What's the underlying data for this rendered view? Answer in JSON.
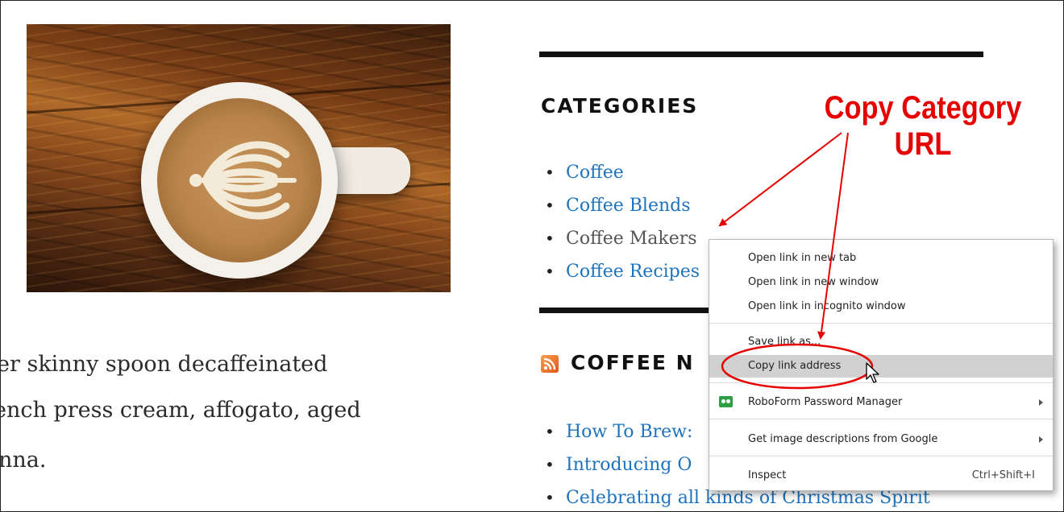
{
  "article": {
    "lines": [
      "er skinny spoon decaffeinated",
      "ench press cream, affogato, aged",
      "nna."
    ]
  },
  "categories_widget": {
    "title": "CATEGORIES",
    "items": [
      {
        "label": "Coffee"
      },
      {
        "label": "Coffee Blends"
      },
      {
        "label": "Coffee Makers"
      },
      {
        "label": "Coffee Recipes"
      }
    ]
  },
  "news_widget": {
    "title": "COFFEE N",
    "items": [
      {
        "label": "How To Brew:"
      },
      {
        "label": "Introducing O"
      },
      {
        "label": "Celebrating all kinds of Christmas Spirit"
      }
    ]
  },
  "annotation": {
    "line1": "Copy Category",
    "line2": "URL",
    "color": "#e60000"
  },
  "context_menu": {
    "open_new_tab": "Open link in new tab",
    "open_new_window": "Open link in new window",
    "open_incognito": "Open link in incognito window",
    "save_link": "Save link as...",
    "copy_link": "Copy link address",
    "roboform": "RoboForm Password Manager",
    "image_desc": "Get image descriptions from Google",
    "inspect": "Inspect",
    "inspect_shortcut": "Ctrl+Shift+I"
  },
  "colors": {
    "link": "#1e73be",
    "highlight": "#d1d1d1"
  }
}
